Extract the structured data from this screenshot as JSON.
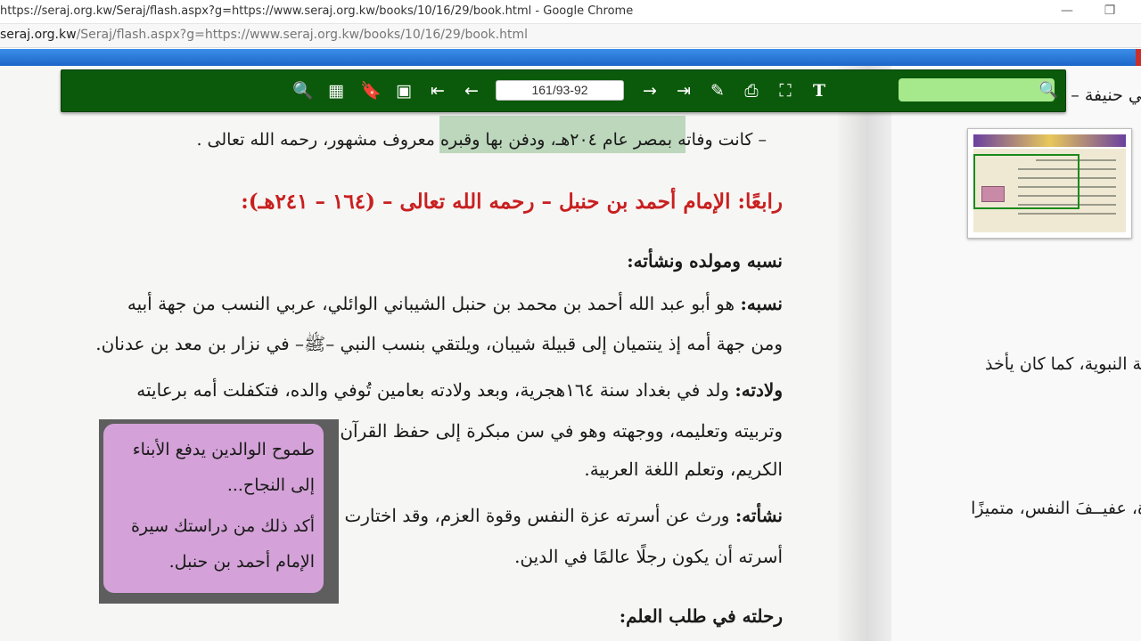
{
  "browser": {
    "title": "https://seraj.org.kw/Seraj/flash.aspx?g=https://www.seraj.org.kw/books/10/16/29/book.html - Google Chrome",
    "url_host": "seraj.org.kw",
    "url_path": "/Seraj/flash.aspx?g=https://www.seraj.org.kw/books/10/16/29/book.html",
    "minimize_glyph": "—",
    "restore_glyph": "❐"
  },
  "toolbar": {
    "icons": {
      "zoom_out": "🔍",
      "thumbnails": "▦",
      "bookmark": "🔖",
      "single_page": "▣",
      "first": "⇤",
      "prev": "←",
      "next": "→",
      "last": "⇥",
      "edit": "✎",
      "print": "⎙",
      "fullscreen": "⛶",
      "text": "T",
      "search": "🔍"
    },
    "page_value": "161/93-92",
    "search_value": ""
  },
  "page": {
    "line1": "– كانت وفاته بمصر عام ٢٠٤هـ، ودفن بها وقبره معروف مشهور، رحمه الله تعالى .",
    "heading": "رابعًا: الإمام أحمد بن حنبل – رحمه الله تعالى – (١٦٤ – ٢٤١هـ):",
    "subheading1": "نسبه ومولده ونشأته:",
    "nasab_label": "نسبه:",
    "nasab_line1": "هو أبو عبد الله أحمد بن محمد بن حنبل الشيباني الوائلي، عربي النسب من جهة أبيه",
    "nasab_line2": "ومن جهة أمه إذ ينتميان إلى قبيلة شيبان، ويلتقي بنسب النبي –ﷺ– في نزار بن معد بن عدنان.",
    "wiladah_label": "ولادته:",
    "wiladah_line1": "ولد في بغداد سنة ١٦٤هجرية، وبعد ولادته بعامين تُوفي والده، فتكفلت أمه برعايته",
    "wiladah_line2": "وتربيته وتعليمه، ووجهته وهو في سن مبكرة إلى حفظ القرآن",
    "wiladah_line3": "الكريم، وتعلم اللغة العربية.",
    "nashah_label": "نشأته:",
    "nashah_line1": "ورث عن أسرته عزة النفس وقوة العزم، وقد اختارت",
    "nashah_line2": "أسرته أن يكون رجلًا عالمًا في الدين.",
    "subheading2": "رحلته في طلب العلم:",
    "callout_line1": "طموح الوالدين يدفع الأبناء",
    "callout_line2": "إلى النجاح...",
    "callout_line3": "أكد ذلك من دراستك سيرة",
    "callout_line4": "الإمام أحمد بن حنبل."
  },
  "right_page": {
    "line1": "بي حنيفة –",
    "line2": "نة النبوية، كما كان يأخذ",
    "line3": "ة، عفيــفَ النفس، متميزًا"
  }
}
